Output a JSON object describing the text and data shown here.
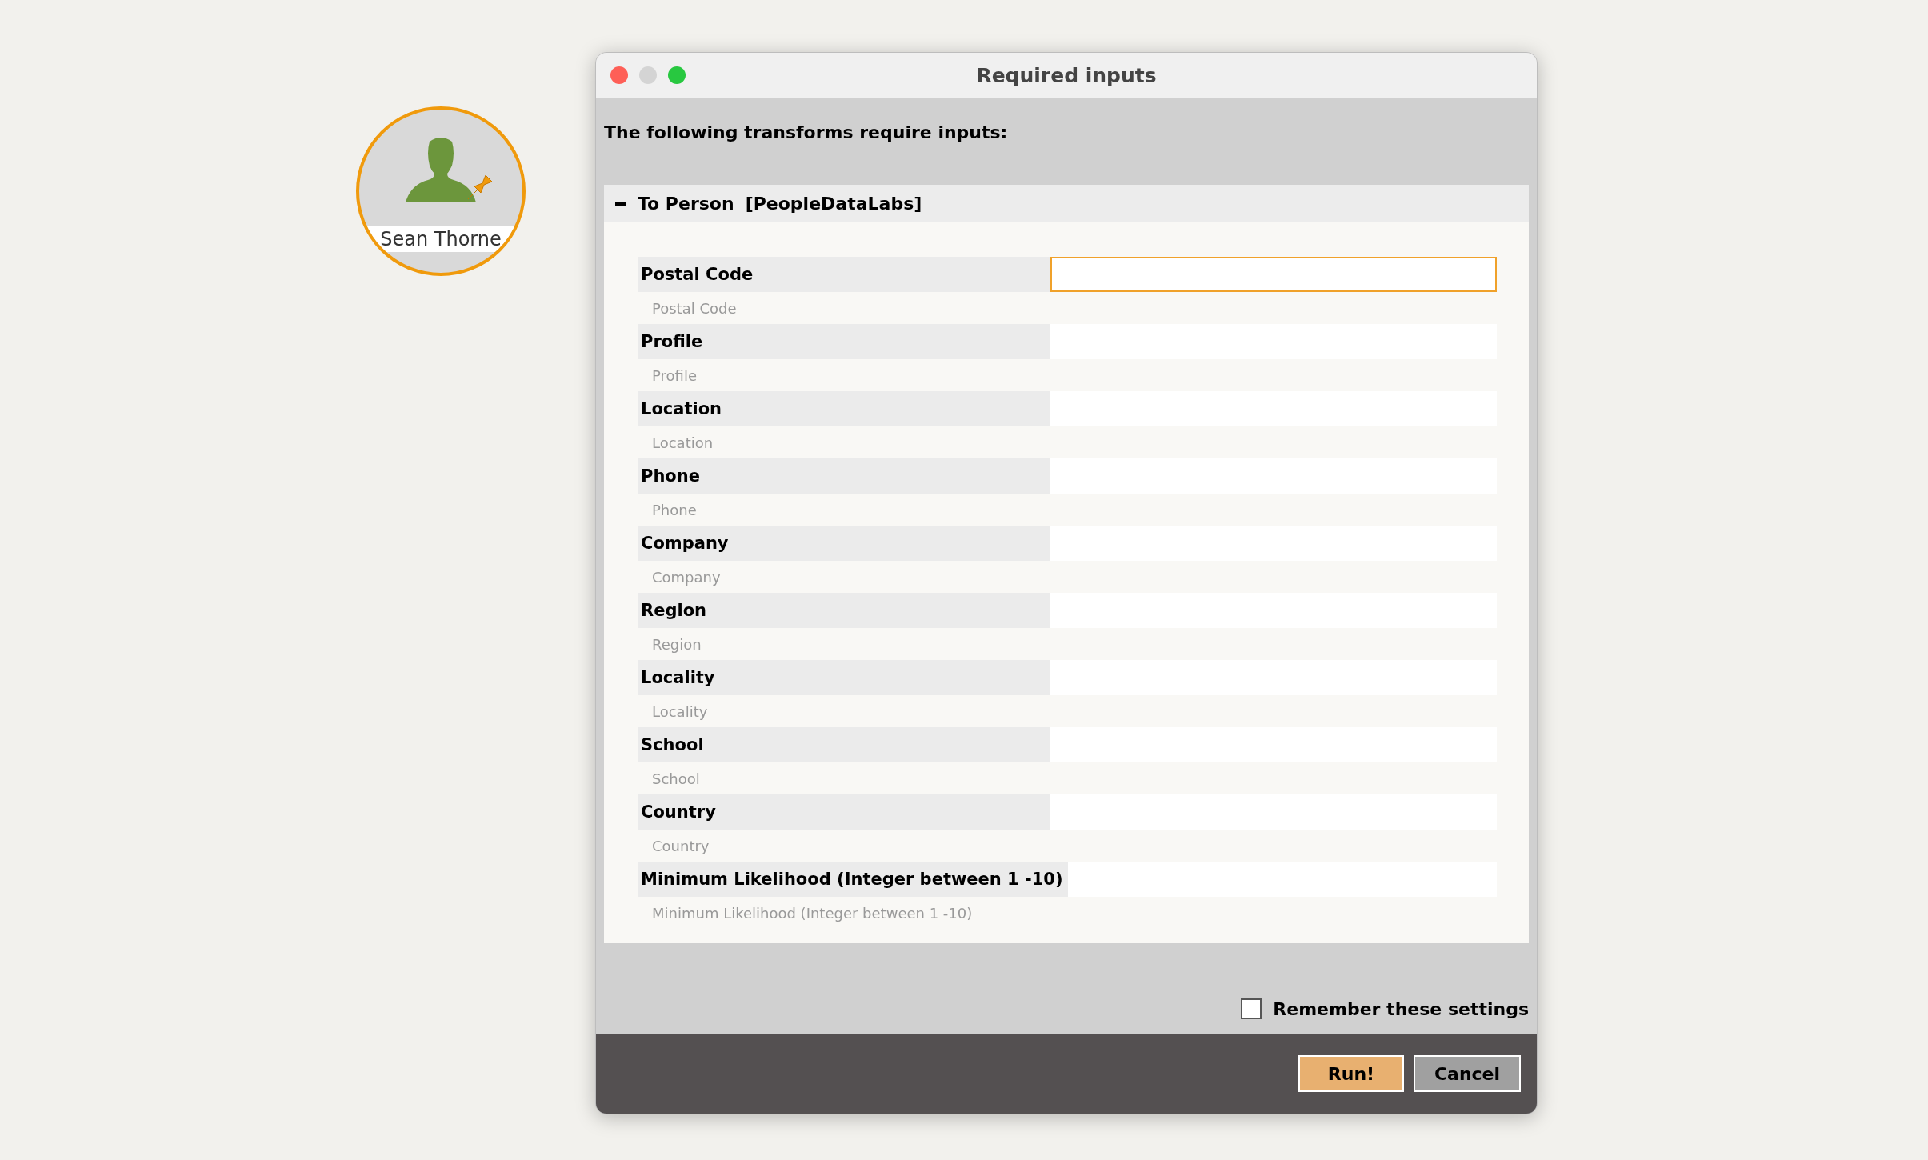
{
  "canvas": {
    "node": {
      "label": "Sean Thorne",
      "selected": true
    }
  },
  "dialog": {
    "title": "Required inputs",
    "intro": "The following transforms require inputs:",
    "section": {
      "title": "To Person",
      "source": "[PeopleDataLabs]",
      "expanded": true,
      "fields": [
        {
          "label": "Postal Code",
          "hint": "Postal Code",
          "focused": true
        },
        {
          "label": "Profile",
          "hint": "Profile",
          "focused": false
        },
        {
          "label": "Location",
          "hint": "Location",
          "focused": false
        },
        {
          "label": "Phone",
          "hint": "Phone",
          "focused": false
        },
        {
          "label": "Company",
          "hint": "Company",
          "focused": false
        },
        {
          "label": "Region",
          "hint": "Region",
          "focused": false
        },
        {
          "label": "Locality",
          "hint": "Locality",
          "focused": false
        },
        {
          "label": "School",
          "hint": "School",
          "focused": false
        },
        {
          "label": "Country",
          "hint": "Country",
          "focused": false
        },
        {
          "label": "Minimum Likelihood (Integer between 1 -10)",
          "hint": "Minimum Likelihood (Integer between 1 -10)",
          "focused": false
        }
      ]
    },
    "remember": {
      "label": "Remember these settings",
      "checked": false
    },
    "buttons": [
      {
        "label": "Run!",
        "kind": "primary"
      },
      {
        "label": "Cancel",
        "kind": "secondary"
      }
    ]
  }
}
